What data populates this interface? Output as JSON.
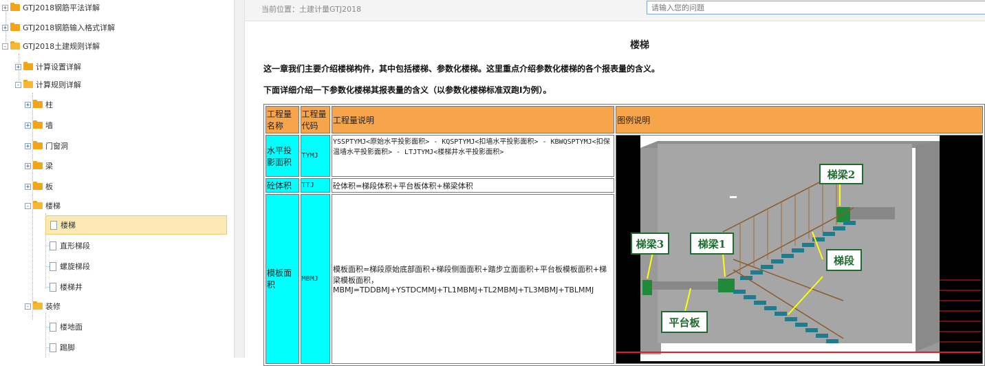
{
  "sidebar": {
    "items": [
      {
        "label": "GTJ2018钢筋平法详解",
        "toggle": "+",
        "type": "folder"
      },
      {
        "label": "GTJ2018钢筋输入格式详解",
        "toggle": "+",
        "type": "folder"
      },
      {
        "label": "GTJ2018土建规则详解",
        "toggle": "-",
        "type": "folder"
      },
      {
        "label": "计算设置详解",
        "toggle": "+",
        "type": "folder"
      },
      {
        "label": "计算规则详解",
        "toggle": "-",
        "type": "folder"
      },
      {
        "label": "柱",
        "toggle": "+",
        "type": "folder"
      },
      {
        "label": "墙",
        "toggle": "+",
        "type": "folder"
      },
      {
        "label": "门窗洞",
        "toggle": "+",
        "type": "folder"
      },
      {
        "label": "梁",
        "toggle": "+",
        "type": "folder"
      },
      {
        "label": "板",
        "toggle": "+",
        "type": "folder"
      },
      {
        "label": "楼梯",
        "toggle": "-",
        "type": "folder"
      },
      {
        "label": "楼梯",
        "toggle": "",
        "type": "doc",
        "selected": true
      },
      {
        "label": "直形梯段",
        "toggle": "",
        "type": "doc"
      },
      {
        "label": "螺旋梯段",
        "toggle": "",
        "type": "doc"
      },
      {
        "label": "楼梯井",
        "toggle": "",
        "type": "doc"
      },
      {
        "label": "装修",
        "toggle": "-",
        "type": "folder"
      },
      {
        "label": "楼地面",
        "toggle": "",
        "type": "doc"
      },
      {
        "label": "踢脚",
        "toggle": "",
        "type": "doc"
      }
    ]
  },
  "header": {
    "breadcrumb": "当前位置：土建计量GTJ2018",
    "search_placeholder": "请输入您的问题"
  },
  "main": {
    "title": "楼梯",
    "intro": "这一章我们主要介绍楼梯构件，其中包括楼梯、参数化楼梯。这里重点介绍参数化楼梯的各个报表量的含义。",
    "intro2": "下面详细介绍一下参数化楼梯其报表量的含义（以参数化楼梯标准双跑I为例）。",
    "table": {
      "headers": [
        "工程量名称",
        "工程量代码",
        "工程量说明",
        "图例说明"
      ],
      "rows": [
        {
          "name": "水平投影面积",
          "code": "TYMJ",
          "desc": "YSSPTYMJ<原始水平投影面积> - KQSPTYMJ<扣墙水平投影面积> - KBWQSPTYMJ<扣保温墙水平投影面积> - LTJTYMJ<楼梯井水平投影面积>"
        },
        {
          "name": "砼体积",
          "code": "TTJ",
          "desc": "砼体积=梯段体积+平台板体积+梯梁体积"
        },
        {
          "name": "模板面积",
          "code": "MBMJ",
          "desc": "模板面积=梯段原始底部面积+梯段侧面面积+踏步立面面积+平台板模板面积+梯梁模板面积，MBMJ=TDDBMJ+YSTDCMMJ+TL1MBMJ+TL2MBMJ+TL3MBMJ+TBLMMJ"
        }
      ]
    },
    "figure_labels": {
      "beam2": "梯梁2",
      "beam3": "梯梁3",
      "beam1": "梯梁1",
      "flight": "梯段",
      "platform": "平台板"
    }
  },
  "colors": {
    "header_orange": "#f7a54a",
    "cyan": "#00ffff",
    "folder": "#f2a516"
  }
}
